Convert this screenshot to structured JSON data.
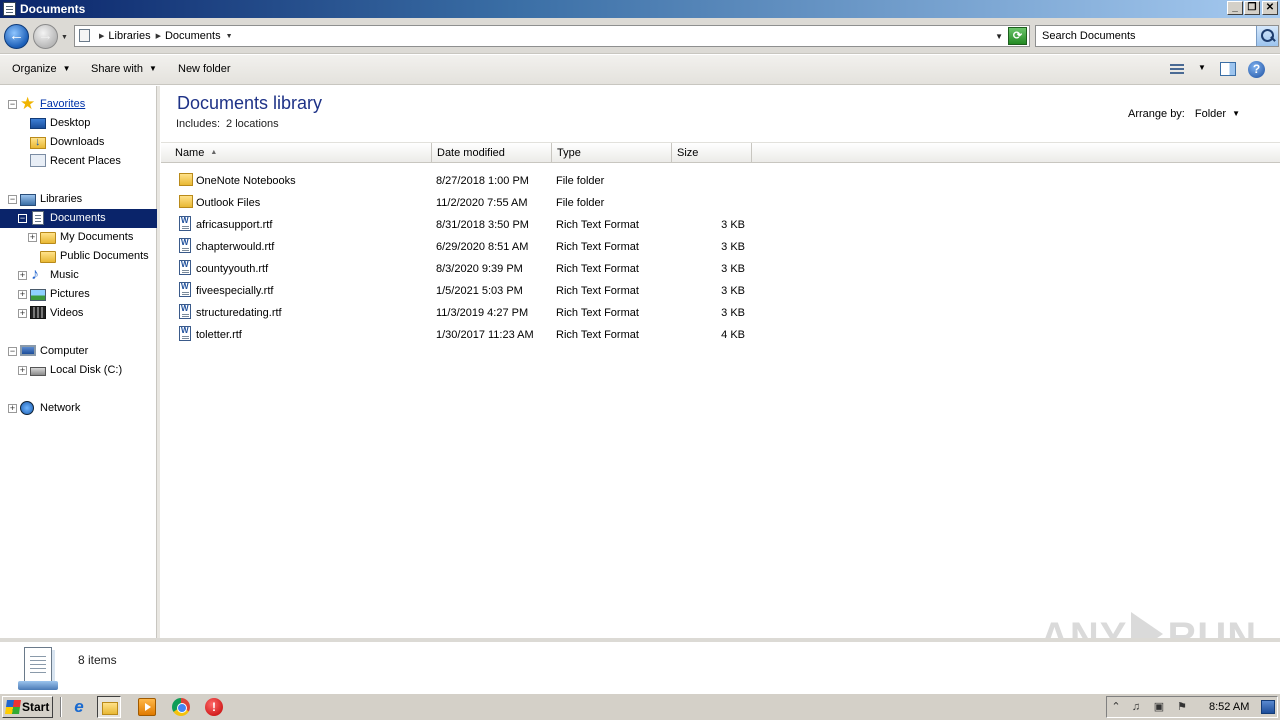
{
  "window": {
    "title": "Documents",
    "buttons": {
      "minimize": "_",
      "restore": "❐",
      "close": "✕"
    }
  },
  "address": {
    "breadcrumbs": [
      "Libraries",
      "Documents"
    ],
    "search_placeholder": "Search Documents"
  },
  "toolbar": {
    "organize": "Organize",
    "share_with": "Share with",
    "new_folder": "New folder"
  },
  "sidebar": {
    "favorites": {
      "label": "Favorites",
      "items": [
        {
          "label": "Desktop",
          "icon": "desktop-icon"
        },
        {
          "label": "Downloads",
          "icon": "downloads-folder-icon"
        },
        {
          "label": "Recent Places",
          "icon": "recent-places-icon"
        }
      ]
    },
    "libraries": {
      "label": "Libraries",
      "items": [
        {
          "label": "Documents",
          "icon": "documents-icon",
          "selected": true
        },
        {
          "label": "My Documents",
          "icon": "folder-icon"
        },
        {
          "label": "Public Documents",
          "icon": "folder-icon"
        },
        {
          "label": "Music",
          "icon": "music-icon"
        },
        {
          "label": "Pictures",
          "icon": "pictures-icon"
        },
        {
          "label": "Videos",
          "icon": "videos-icon"
        }
      ]
    },
    "computer": {
      "label": "Computer",
      "items": [
        {
          "label": "Local Disk (C:)",
          "icon": "disk-icon"
        }
      ]
    },
    "network": {
      "label": "Network"
    }
  },
  "content": {
    "title": "Documents library",
    "includes_label": "Includes:",
    "includes_value": "2 locations",
    "arrange_label": "Arrange by:",
    "arrange_value": "Folder",
    "columns": [
      "Name",
      "Date modified",
      "Type",
      "Size"
    ],
    "files": [
      {
        "name": "OneNote Notebooks",
        "date": "8/27/2018 1:00 PM",
        "type": "File folder",
        "size": "",
        "icon": "folder-icon"
      },
      {
        "name": "Outlook Files",
        "date": "11/2/2020 7:55 AM",
        "type": "File folder",
        "size": "",
        "icon": "folder-icon"
      },
      {
        "name": "africasupport.rtf",
        "date": "8/31/2018 3:50 PM",
        "type": "Rich Text Format",
        "size": "3 KB",
        "icon": "rtf-file-icon"
      },
      {
        "name": "chapterwould.rtf",
        "date": "6/29/2020 8:51 AM",
        "type": "Rich Text Format",
        "size": "3 KB",
        "icon": "rtf-file-icon"
      },
      {
        "name": "countyyouth.rtf",
        "date": "8/3/2020 9:39 PM",
        "type": "Rich Text Format",
        "size": "3 KB",
        "icon": "rtf-file-icon"
      },
      {
        "name": "fiveespecially.rtf",
        "date": "1/5/2021 5:03 PM",
        "type": "Rich Text Format",
        "size": "3 KB",
        "icon": "rtf-file-icon"
      },
      {
        "name": "structuredating.rtf",
        "date": "11/3/2019 4:27 PM",
        "type": "Rich Text Format",
        "size": "3 KB",
        "icon": "rtf-file-icon"
      },
      {
        "name": "toletter.rtf",
        "date": "1/30/2017 11:23 AM",
        "type": "Rich Text Format",
        "size": "4 KB",
        "icon": "rtf-file-icon"
      }
    ]
  },
  "details": {
    "count": "8 items"
  },
  "watermark": {
    "left": "ANY",
    "right": "RUN"
  },
  "taskbar": {
    "start": "Start",
    "time": "8:52 AM"
  }
}
